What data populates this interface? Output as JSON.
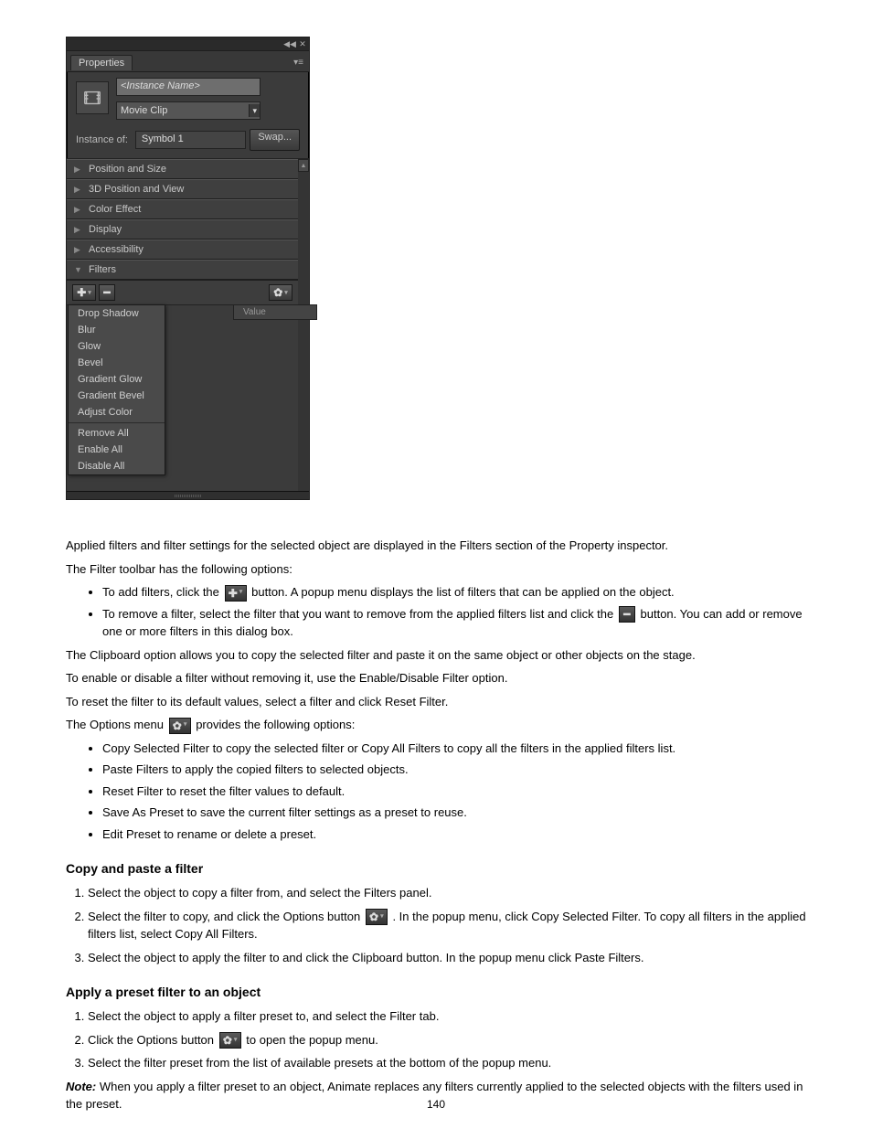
{
  "panel": {
    "tab_label": "Properties",
    "instance_name_placeholder": "<Instance Name>",
    "type_dropdown": "Movie Clip",
    "instance_of_label": "Instance of:",
    "instance_of_value": "Symbol 1",
    "swap_label": "Swap...",
    "sections": [
      {
        "label": "Position and Size",
        "open": false
      },
      {
        "label": "3D Position and View",
        "open": false
      },
      {
        "label": "Color Effect",
        "open": false
      },
      {
        "label": "Display",
        "open": false
      },
      {
        "label": "Accessibility",
        "open": false
      },
      {
        "label": "Filters",
        "open": true
      }
    ],
    "filters_header_value": "Value",
    "filter_menu": {
      "items": [
        "Drop Shadow",
        "Blur",
        "Glow",
        "Bevel",
        "Gradient Glow",
        "Gradient Bevel",
        "Adjust Color"
      ],
      "actions": [
        "Remove All",
        "Enable All",
        "Disable All"
      ]
    }
  },
  "doc": {
    "para_intro": "Applied filters and filter settings for the selected object are displayed in the Filters section of the Property inspector.",
    "para_toolbar": "The Filter toolbar has the following options:",
    "bullet_add_pre": "To add filters, click the",
    "bullet_add_post": "button. A popup menu displays the list of filters that can be applied on the object.",
    "bullet_remove_pre": "To remove a filter, select the filter that you want to remove from the applied filters list and click the",
    "bullet_remove_post": "button. You can add or remove one or more filters in this dialog box.",
    "para_clipboard": "The Clipboard option allows you to copy  the selected filter and paste it on the same object or other objects on the stage.",
    "para_enable": "To enable or disable a filter without removing it, use the Enable/Disable Filter option.",
    "para_reset": "To reset the filter to its default values, select a filter and click Reset Filter.",
    "para_options": "The Options menu",
    "para_options_post": "  provides the following options:",
    "bullet_copy": "Copy Selected Filter to copy the selected filter or Copy All Filters to copy all the filters in the applied filters list.",
    "bullet_paste": "Paste Filters to apply the copied filters to selected objects.",
    "bullet_resetf": "Reset Filter to reset the filter values to default.",
    "bullet_savepreset": "Save As Preset to save the current filter settings as a preset to reuse.",
    "bullet_editpreset": "Edit Preset to rename or delete a preset.",
    "h_copypaste": "Copy and paste a filter",
    "cp_step1": "Select the object to copy a filter from, and select the Filters panel.",
    "cp_step2_pre": "Select the filter to copy, and click the Options button",
    "cp_step2_post": ". In the popup menu, click Copy Selected Filter. To copy all filters in the applied filters list, select Copy All Filters.",
    "cp_step3": "Select the object to apply the filter to and click the Clipboard button. In the popup menu click Paste Filters.",
    "h_applypreset": "Apply a preset filter to an object",
    "ap_step1": "Select the object to apply a filter preset to, and select the Filter tab.",
    "ap_step2_pre": "Click the Options button",
    "ap_step2_post": "  to open the popup menu.",
    "ap_step3": "Select the filter preset from the list of available presets at the bottom of the popup menu.",
    "note_label": "Note:",
    "note_text": "When you apply a filter preset to an object, Animate replaces any filters currently applied to the selected objects with the filters used in the preset."
  },
  "page_number": "140"
}
